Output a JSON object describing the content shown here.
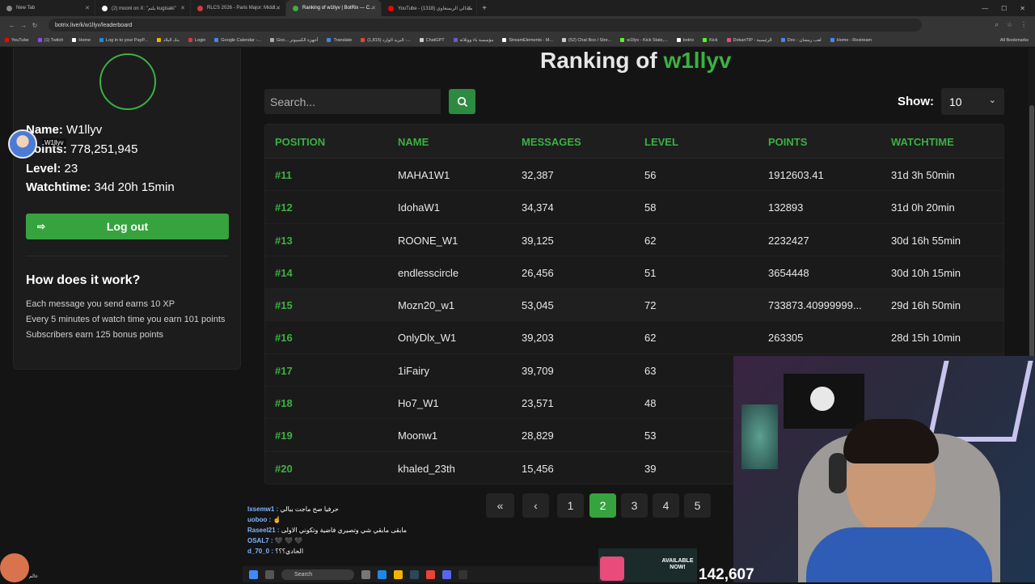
{
  "browser": {
    "tabs": [
      {
        "label": "New Tab",
        "color": "#888888",
        "active": false
      },
      {
        "label": "(2) moonl on X: \"يلتم kugisaki\"",
        "color": "#ffffff",
        "active": false
      },
      {
        "label": "RLCS 2026 - Paris Major: Middl...",
        "color": "#d33b3b",
        "active": false
      },
      {
        "label": "Ranking of w1llyv | BotRix — C...",
        "color": "#3cb043",
        "active": true
      },
      {
        "label": "YouTube - (1318) ميدالي الريمنغاوي",
        "color": "#ff0000",
        "active": false
      }
    ],
    "url": "botrix.live/k/w1llyv/leaderboard",
    "bookmarks": [
      {
        "label": "YouTube",
        "color": "#ff0000"
      },
      {
        "label": "(1) Twitch",
        "color": "#9146ff"
      },
      {
        "label": "Home",
        "color": "#ffffff"
      },
      {
        "label": "Log in to your PayP...",
        "color": "#1e88e5"
      },
      {
        "label": "بنك البلاد",
        "color": "#f2b400"
      },
      {
        "label": "Login",
        "color": "#d33b3b"
      },
      {
        "label": "Google Calendar -...",
        "color": "#4285f4"
      },
      {
        "label": "Goo... أجهزة الكمبيوتر",
        "color": "#aaaaaa"
      },
      {
        "label": "Translate",
        "color": "#4285f4"
      },
      {
        "label": "(1,815) البريد الوارد -...",
        "color": "#ea4335"
      },
      {
        "label": "ChatGPT",
        "color": "#cccccc"
      },
      {
        "label": "مؤسسة باء ووثلاثة",
        "color": "#6a5acd"
      },
      {
        "label": "StreamElements - M...",
        "color": "#ffffff"
      },
      {
        "label": "(52) Chat Box / Stre...",
        "color": "#cccccc"
      },
      {
        "label": "w1llyv - Kick Stats,...",
        "color": "#53fc18"
      },
      {
        "label": "botrix",
        "color": "#ffffff"
      },
      {
        "label": "Kick",
        "color": "#53fc18"
      },
      {
        "label": "DokanTIP - الرئيسية",
        "color": "#e94b7a"
      },
      {
        "label": "Doc - لعب رمضان",
        "color": "#4285f4"
      },
      {
        "label": "Home - Restream",
        "color": "#3d8bfd"
      }
    ],
    "all_bookmarks": "All Bookmarks"
  },
  "profile": {
    "name_label": "Name:",
    "name": "W1llyv",
    "points_label": "Points:",
    "points": "778,251,945",
    "level_label": "Level:",
    "level": "23",
    "watchtime_label": "Watchtime:",
    "watchtime": "34d 20h 15min",
    "logout": "Log out",
    "overlay_name": "W1llyv"
  },
  "how": {
    "title": "How does it work?",
    "lines": [
      "Each message you send earns 10 XP",
      "Every 5 minutes of watch time you earn 101 points",
      "Subscribers earn 125 bonus points"
    ]
  },
  "main": {
    "title_prefix": "Ranking of ",
    "title_user": "w1llyv",
    "search_placeholder": "Search...",
    "show_label": "Show:",
    "show_value": "10"
  },
  "table": {
    "headers": [
      "POSITION",
      "NAME",
      "MESSAGES",
      "LEVEL",
      "POINTS",
      "WATCHTIME"
    ],
    "rows": [
      [
        "#11",
        "MAHA1W1",
        "32,387",
        "56",
        "1912603.41",
        "31d 3h 50min"
      ],
      [
        "#12",
        "IdohaW1",
        "34,374",
        "58",
        "132893",
        "31d 0h 20min"
      ],
      [
        "#13",
        "ROONE_W1",
        "39,125",
        "62",
        "2232427",
        "30d 16h 55min"
      ],
      [
        "#14",
        "endlesscircle",
        "26,456",
        "51",
        "3654448",
        "30d 10h 15min"
      ],
      [
        "#15",
        "Mozn20_w1",
        "53,045",
        "72",
        "733873.40999999...",
        "29d 16h 50min"
      ],
      [
        "#16",
        "OnlyDlx_W1",
        "39,203",
        "62",
        "263305",
        "28d 15h 10min"
      ],
      [
        "#17",
        "1iFairy",
        "39,709",
        "63",
        "",
        ""
      ],
      [
        "#18",
        "Ho7_W1",
        "23,571",
        "48",
        "",
        ""
      ],
      [
        "#19",
        "Moonw1",
        "28,829",
        "53",
        "",
        ""
      ],
      [
        "#20",
        "khaled_23th",
        "15,456",
        "39",
        "",
        ""
      ]
    ]
  },
  "pagination": {
    "first": "«",
    "prev": "‹",
    "pages": [
      "1",
      "2",
      "3",
      "4",
      "5"
    ],
    "current": "2"
  },
  "overlay": {
    "chat": [
      {
        "user": "lxsemw1 :",
        "msg": "حرفيا صح ماجت ببالي"
      },
      {
        "user": "uoboo :",
        "msg": "☝"
      },
      {
        "user": "Raseel21 :",
        "msg": "مابقى مابقي شي وتصيري فاضية وتكوني الاولى"
      },
      {
        "user": "OSAL7 :",
        "msg": "🖤 🖤 🖤"
      },
      {
        "user": "d_70_0 :",
        "msg": "الحادي؟؟؟"
      }
    ],
    "taskbar_search": "Search",
    "available": "AVAILABLE NOW!",
    "counter": "142,607",
    "corner_text": "عالم"
  }
}
